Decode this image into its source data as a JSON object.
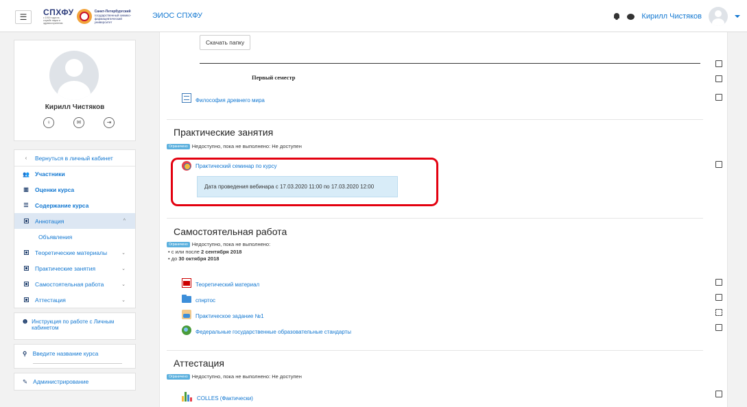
{
  "header": {
    "logo_abbr": "СПХФУ",
    "logo_tagline": "с 1919 года на службе науки и здравоохранения",
    "logo_university": "Санкт-Петербургский государственный химико-фармацевтический университет",
    "logo_university_title": "Санкт-Петербургский",
    "logo_university_rest": "государственный химико-фармацевтический университет",
    "site_name": "ЭИОС СПХФУ",
    "user_name": "Кирилл Чистяков"
  },
  "profile": {
    "name": "Кирилл Чистяков",
    "icons": [
      "profile-icon",
      "message-icon",
      "logout-icon"
    ]
  },
  "nav": {
    "back": "Вернуться в личный кабинет",
    "participants": "Участники",
    "grades": "Оценки курса",
    "contents": "Содержание курса",
    "annotation": "Аннотация",
    "announcements": "Объявления",
    "theory": "Теоретические материалы",
    "practice": "Практические занятия",
    "selfwork": "Самостоятельная работа",
    "attestation": "Аттестация"
  },
  "info": {
    "instruction": "Инструкция по работе с Личным кабинетом"
  },
  "search": {
    "placeholder": "Введите название курса"
  },
  "admin": {
    "label": "Администрирование"
  },
  "main": {
    "download_button": "Скачать папку",
    "semester_label": "Первый семестр",
    "philosophy_link": "Философия древнего мира",
    "practice": {
      "title": "Практические занятия",
      "badge": "Ограничено",
      "restriction": "Недоступно, пока не выполнено: Не доступен",
      "webinar_link": "Практический семинар по курсу",
      "webinar_dates": "Дата проведения вебинара с 17.03.2020 11:00 по 17.03.2020 12:00"
    },
    "selfwork": {
      "title": "Самостоятельная работа",
      "badge": "Ограничено",
      "restriction": "Недоступно, пока не выполнено:",
      "cond1_prefix": "с или после",
      "cond1_date": "2 сентября 2018",
      "cond2_prefix": "до",
      "cond2_date": "30 октября 2018",
      "items": [
        "Теоретический материал",
        "спнртос",
        "Практическое задание №1",
        "Федеральные государственные образовательные стандарты"
      ]
    },
    "attestation": {
      "title": "Аттестация",
      "badge": "Ограничено",
      "restriction": "Недоступно, пока не выполнено: Не доступен",
      "item": "COLLES (Фактически)"
    }
  },
  "colors": {
    "link": "#1177d1",
    "badge": "#5bb0de",
    "highlight_outline": "#e3000f",
    "webinar_box": "#d8ecf8"
  }
}
